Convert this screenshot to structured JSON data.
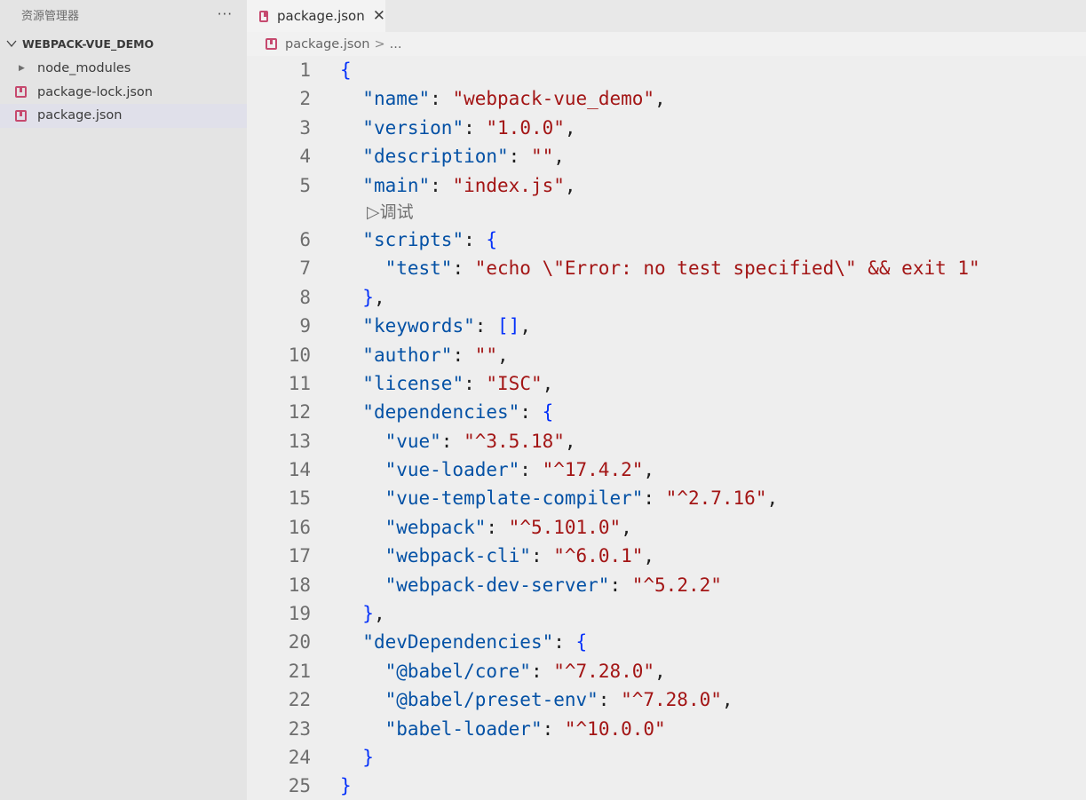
{
  "sidebar": {
    "title": "资源管理器",
    "more": "···",
    "folder": "WEBPACK-VUE_DEMO",
    "items": [
      {
        "label": "node_modules",
        "kind": "folder"
      },
      {
        "label": "package-lock.json",
        "kind": "json"
      },
      {
        "label": "package.json",
        "kind": "json",
        "selected": true
      }
    ]
  },
  "editor": {
    "tab": {
      "label": "package.json",
      "close": "✕"
    },
    "breadcrumb": {
      "file": "package.json",
      "sep": ">",
      "more": "..."
    },
    "codelens": "▷调试",
    "lines": [
      {
        "n": "1",
        "t": "{"
      },
      {
        "n": "2",
        "t": "  \"name\": \"webpack-vue_demo\","
      },
      {
        "n": "3",
        "t": "  \"version\": \"1.0.0\","
      },
      {
        "n": "4",
        "t": "  \"description\": \"\","
      },
      {
        "n": "5",
        "t": "  \"main\": \"index.js\","
      },
      {
        "n": "6",
        "t": "  \"scripts\": {"
      },
      {
        "n": "7",
        "t": "    \"test\": \"echo \\\"Error: no test specified\\\" && exit 1\""
      },
      {
        "n": "8",
        "t": "  },"
      },
      {
        "n": "9",
        "t": "  \"keywords\": [],"
      },
      {
        "n": "10",
        "t": "  \"author\": \"\","
      },
      {
        "n": "11",
        "t": "  \"license\": \"ISC\","
      },
      {
        "n": "12",
        "t": "  \"dependencies\": {"
      },
      {
        "n": "13",
        "t": "    \"vue\": \"^3.5.18\","
      },
      {
        "n": "14",
        "t": "    \"vue-loader\": \"^17.4.2\","
      },
      {
        "n": "15",
        "t": "    \"vue-template-compiler\": \"^2.7.16\","
      },
      {
        "n": "16",
        "t": "    \"webpack\": \"^5.101.0\","
      },
      {
        "n": "17",
        "t": "    \"webpack-cli\": \"^6.0.1\","
      },
      {
        "n": "18",
        "t": "    \"webpack-dev-server\": \"^5.2.2\""
      },
      {
        "n": "19",
        "t": "  },"
      },
      {
        "n": "20",
        "t": "  \"devDependencies\": {"
      },
      {
        "n": "21",
        "t": "    \"@babel/core\": \"^7.28.0\","
      },
      {
        "n": "22",
        "t": "    \"@babel/preset-env\": \"^7.28.0\","
      },
      {
        "n": "23",
        "t": "    \"babel-loader\": \"^10.0.0\""
      },
      {
        "n": "24",
        "t": "  }"
      },
      {
        "n": "25",
        "t": "}"
      }
    ]
  },
  "colors": {
    "key": "#0451a5",
    "string": "#a31515",
    "bracket_level1": "#0431fa",
    "bracket_level2": "#319331",
    "json_icon": "#c64a6f"
  },
  "icons": [
    "more-icon",
    "chevron-down-icon",
    "caret-right-icon",
    "json-file-icon",
    "close-icon",
    "chevron-right-icon"
  ]
}
